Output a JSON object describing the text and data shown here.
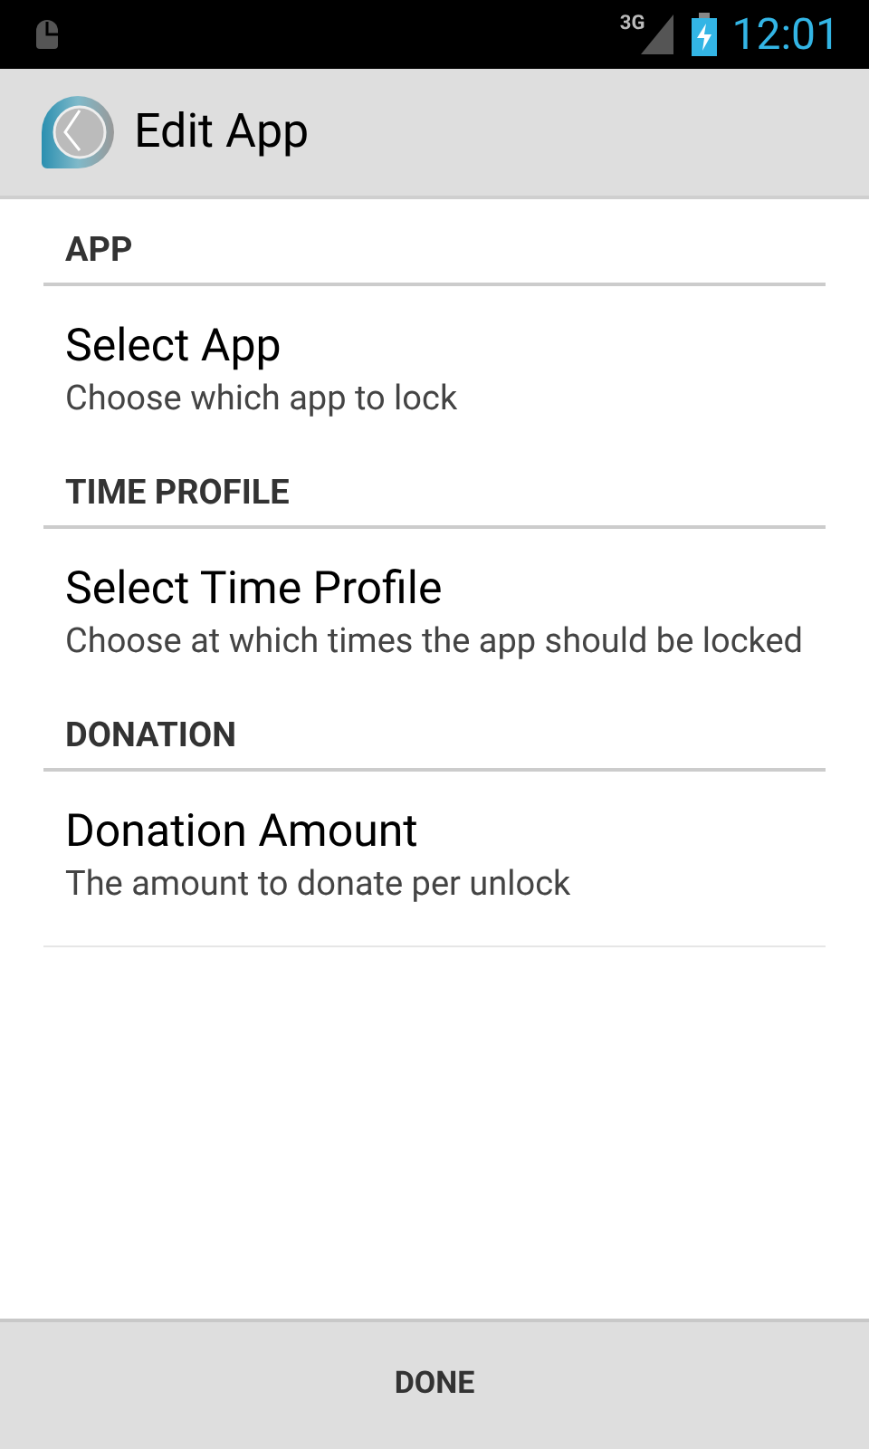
{
  "status_bar": {
    "network": "3G",
    "time": "12:01"
  },
  "action_bar": {
    "title": "Edit App"
  },
  "sections": [
    {
      "header": "APP",
      "items": [
        {
          "title": "Select App",
          "summary": "Choose which app to lock"
        }
      ]
    },
    {
      "header": "TIME PROFILE",
      "items": [
        {
          "title": "Select Time Profile",
          "summary": "Choose at which times the app should be locked"
        }
      ]
    },
    {
      "header": "DONATION",
      "items": [
        {
          "title": "Donation Amount",
          "summary": "The amount to donate per unlock"
        }
      ]
    }
  ],
  "footer_button": "DONE"
}
